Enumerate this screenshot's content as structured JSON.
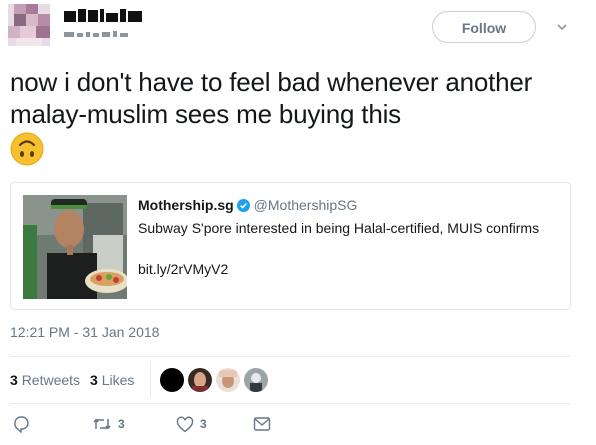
{
  "header": {
    "follow_label": "Follow"
  },
  "tweet": {
    "text": "now i don't have to feel bad whenever another malay-muslim sees me buying this",
    "emoji": "upside-down-face-emoji"
  },
  "quoted_card": {
    "author_name": "Mothership.sg",
    "author_handle": "@MothershipSG",
    "verified": true,
    "text": "Subway S'pore interested in being Halal-certified, MUIS confirms",
    "link": "bit.ly/2rVMyV2"
  },
  "timestamp": "12:21 PM - 31 Jan 2018",
  "stats": {
    "retweets_count": "3",
    "retweets_label": "Retweets",
    "likes_count": "3",
    "likes_label": "Likes"
  },
  "actions": {
    "reply_count": "",
    "retweet_count": "3",
    "like_count": "3"
  },
  "icons": {
    "reply": "reply-icon",
    "retweet": "retweet-icon",
    "like": "heart-icon",
    "message": "envelope-icon",
    "verified": "verified-badge-icon",
    "caret": "chevron-down-icon"
  },
  "colors": {
    "text": "#14171a",
    "secondary": "#657786",
    "border": "#e1e8ed",
    "verified": "#1da1f2"
  }
}
